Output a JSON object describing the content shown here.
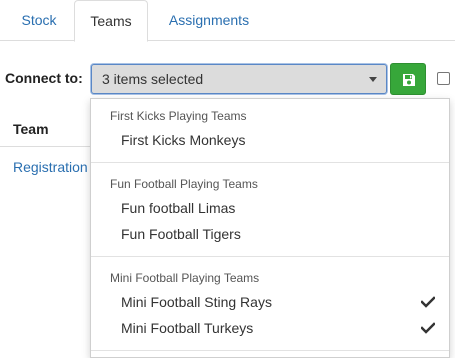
{
  "tabs": [
    {
      "label": "Stock"
    },
    {
      "label": "Teams"
    },
    {
      "label": "Assignments"
    }
  ],
  "connect": {
    "label": "Connect to:",
    "selected_text": "3 items selected"
  },
  "table": {
    "header": "Team",
    "link_text": "Registration"
  },
  "dropdown": {
    "groups": [
      {
        "header": "First Kicks Playing Teams",
        "options": [
          {
            "label": "First Kicks Monkeys",
            "checked": false
          }
        ]
      },
      {
        "header": "Fun Football Playing Teams",
        "options": [
          {
            "label": "Fun football Limas",
            "checked": false
          },
          {
            "label": "Fun Football Tigers",
            "checked": false
          }
        ]
      },
      {
        "header": "Mini Football Playing Teams",
        "options": [
          {
            "label": "Mini Football Sting Rays",
            "checked": true
          },
          {
            "label": "Mini Football Turkeys",
            "checked": true
          }
        ]
      }
    ]
  },
  "colors": {
    "link": "#2a6fb0",
    "save_button": "#37a73a",
    "select_bg": "#dcdcdc"
  }
}
